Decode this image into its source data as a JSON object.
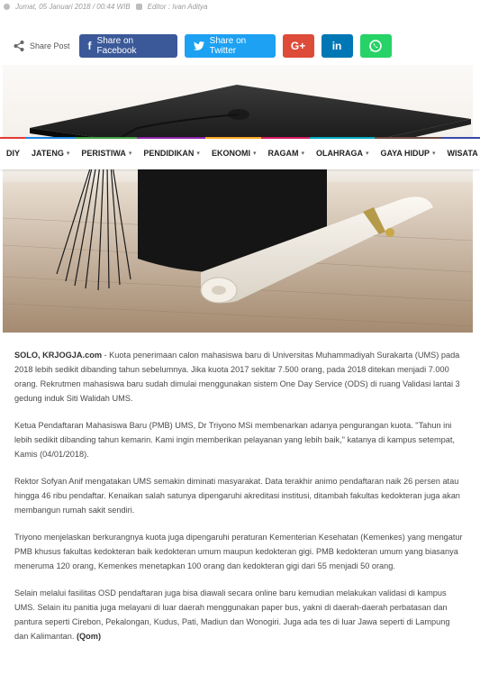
{
  "meta": {
    "date": "Jumat, 05 Januari 2018 / 00:44 WIB",
    "editor": "Editor : Ivan Aditya"
  },
  "share": {
    "label": "Share Post",
    "facebook": "Share on Facebook",
    "twitter": "Share on Twitter",
    "gplus": "G+",
    "linkedin": "in"
  },
  "nav": [
    {
      "label": "DIY",
      "color": "#e53935"
    },
    {
      "label": "JATENG",
      "color": "#1e88e5"
    },
    {
      "label": "PERISTIWA",
      "color": "#43a047"
    },
    {
      "label": "PENDIDIKAN",
      "color": "#8e24aa"
    },
    {
      "label": "EKONOMI",
      "color": "#f9a825"
    },
    {
      "label": "RAGAM",
      "color": "#d81b60"
    },
    {
      "label": "OLAHRAGA",
      "color": "#00acc1"
    },
    {
      "label": "GAYA HIDUP",
      "color": "#6d4c41"
    },
    {
      "label": "WISATA",
      "color": "#3949ab"
    }
  ],
  "article": {
    "dateline": "SOLO, KRJOGJA.com",
    "p1": " - Kuota penerimaan calon mahasiswa baru di Universitas Muhammadiyah Surakarta (UMS) pada 2018 lebih sedikit dibanding tahun sebelumnya. Jika kuota 2017 sekitar 7.500 orang, pada 2018 ditekan menjadi 7.000 orang. Rekrutmen mahasiswa baru sudah dimulai menggunakan sistem One Day Service (ODS) di ruang Validasi lantai 3 gedung induk Siti Walidah UMS.",
    "p2": "Ketua Pendaftaran Mahasiswa Baru (PMB) UMS, Dr Triyono MSi membenarkan adanya pengurangan kuota. \"Tahun ini lebih sedikit dibanding tahun kemarin. Kami ingin memberikan pelayanan yang lebih baik,\" katanya di kampus setempat, Kamis (04/01/2018).",
    "p3": "Rektor Sofyan Anif mengatakan UMS semakin diminati masyarakat. Data terakhir animo pendaftaran naik 26 persen atau hingga 46 ribu pendaftar. Kenaikan salah satunya dipengaruhi akreditasi institusi, ditambah fakultas kedokteran juga akan membangun rumah sakit sendiri.",
    "p4": "Triyono menjelaskan berkurangnya kuota juga dipengaruhi peraturan Kementerian Kesehatan (Kemenkes) yang mengatur PMB khusus fakultas kedokteran baik kedokteran umum maupun kedokteran gigi. PMB kedokteran umum yang biasanya meneruma 120 orang, Kemenkes menetapkan 100 orang dan kedokteran gigi dari 55 menjadi 50 orang.",
    "p5": "Selain melalui fasilitas OSD pendaftaran juga bisa diawali secara online baru kemudian melakukan validasi di kampus UMS. Selain itu panitia juga melayani di luar daerah menggunakan paper bus, yakni di daerah-daerah perbatasan dan pantura seperti Cirebon, Pekalongan, Kudus, Pati, Madiun dan Wonogiri. Juga ada tes di luar Jawa seperti di Lampung dan Kalimantan. ",
    "signature": "(Qom)"
  }
}
